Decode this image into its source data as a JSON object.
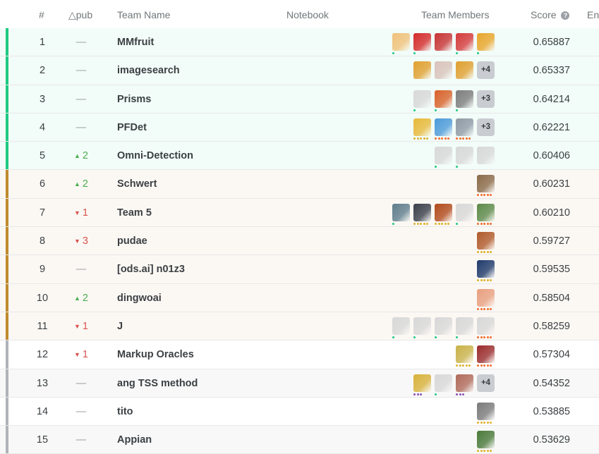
{
  "columns": {
    "rank": "#",
    "delta": "△pub",
    "team": "Team Name",
    "notebook": "Notebook",
    "members": "Team Members",
    "score": "Score",
    "entries": "En"
  },
  "colors": {
    "gold_stripe": "#20beff",
    "green_stripe": "#1ec981",
    "bronze_stripe": "#c08a2e",
    "grey_stripe": "#b0b3b8",
    "up": "#4caf50",
    "down": "#d9534f",
    "row_gold": "#f2fcf8",
    "row_bronze": "#fbf8f4",
    "row_plain": "#f8f8f8"
  },
  "rows": [
    {
      "rank": "1",
      "delta": "—",
      "dir": "none",
      "team": "MMfruit",
      "score": "0.65887",
      "tier": "green",
      "members": [
        {
          "c": "#f0c27a",
          "d": "green"
        },
        {
          "c": "#d42b2b",
          "d": "green"
        },
        {
          "c": "#c73434",
          "d": "none"
        },
        {
          "c": "#d43a3a",
          "d": "green"
        },
        {
          "c": "#e8a62c",
          "d": "green"
        }
      ],
      "more": ""
    },
    {
      "rank": "2",
      "delta": "—",
      "dir": "none",
      "team": "imagesearch",
      "score": "0.65337",
      "tier": "green",
      "members": [
        {
          "c": "#e0a030",
          "d": "none"
        },
        {
          "c": "#d9c3bb",
          "d": "none"
        },
        {
          "c": "#e0a030",
          "d": "none"
        }
      ],
      "more": "+4"
    },
    {
      "rank": "3",
      "delta": "—",
      "dir": "none",
      "team": "Prisms",
      "score": "0.64214",
      "tier": "green",
      "members": [
        {
          "c": "#d8d8d8",
          "d": "green"
        },
        {
          "c": "#d9622a",
          "d": "green"
        },
        {
          "c": "#7d7d7d",
          "d": "green"
        }
      ],
      "more": "+3"
    },
    {
      "rank": "4",
      "delta": "—",
      "dir": "none",
      "team": "PFDet",
      "score": "0.62221",
      "tier": "green",
      "members": [
        {
          "c": "#e8b93a",
          "d": "gold"
        },
        {
          "c": "#4d9ad9",
          "d": "orange"
        },
        {
          "c": "#8f9aa6",
          "d": "orange"
        }
      ],
      "more": "+3"
    },
    {
      "rank": "5",
      "delta": "2",
      "dir": "up",
      "team": "Omni-Detection",
      "score": "0.60406",
      "tier": "green",
      "members": [
        {
          "c": "#d8d8d8",
          "d": "green"
        },
        {
          "c": "#d8d8d8",
          "d": "green"
        },
        {
          "c": "#d8d8d8",
          "d": "none"
        }
      ],
      "more": ""
    },
    {
      "rank": "6",
      "delta": "2",
      "dir": "up",
      "team": "Schwert",
      "score": "0.60231",
      "tier": "bronze",
      "members": [
        {
          "c": "#8a6a4a",
          "d": "orange"
        }
      ],
      "more": ""
    },
    {
      "rank": "7",
      "delta": "1",
      "dir": "down",
      "team": "Team 5",
      "score": "0.60210",
      "tier": "bronze",
      "members": [
        {
          "c": "#5f7d8c",
          "d": "green"
        },
        {
          "c": "#3a3f4a",
          "d": "gold"
        },
        {
          "c": "#b04a1c",
          "d": "gold"
        },
        {
          "c": "#d8d8d8",
          "d": "green"
        },
        {
          "c": "#5d8a4a",
          "d": "orange"
        }
      ],
      "more": ""
    },
    {
      "rank": "8",
      "delta": "3",
      "dir": "down",
      "team": "pudae",
      "score": "0.59727",
      "tier": "bronze",
      "members": [
        {
          "c": "#b05a2a",
          "d": "gold"
        }
      ],
      "more": ""
    },
    {
      "rank": "9",
      "delta": "—",
      "dir": "none",
      "team": "[ods.ai] n01z3",
      "score": "0.59535",
      "tier": "bronze",
      "members": [
        {
          "c": "#1f3a6b",
          "d": "gold"
        }
      ],
      "more": ""
    },
    {
      "rank": "10",
      "delta": "2",
      "dir": "up",
      "team": "dingwoai",
      "score": "0.58504",
      "tier": "bronze",
      "members": [
        {
          "c": "#e8a080",
          "d": "orange"
        }
      ],
      "more": ""
    },
    {
      "rank": "11",
      "delta": "1",
      "dir": "down",
      "team": "J",
      "score": "0.58259",
      "tier": "bronze",
      "members": [
        {
          "c": "#d8d8d8",
          "d": "green"
        },
        {
          "c": "#d8d8d8",
          "d": "green"
        },
        {
          "c": "#d8d8d8",
          "d": "green"
        },
        {
          "c": "#d8d8d8",
          "d": "green"
        },
        {
          "c": "#d8d8d8",
          "d": "orange"
        }
      ],
      "more": ""
    },
    {
      "rank": "12",
      "delta": "1",
      "dir": "down",
      "team": "Markup Oracles",
      "score": "0.57304",
      "tier": "grey",
      "members": [
        {
          "c": "#c9b24a",
          "d": "gold"
        },
        {
          "c": "#9a2c2c",
          "d": "orange"
        }
      ],
      "more": ""
    },
    {
      "rank": "13",
      "delta": "—",
      "dir": "none",
      "team": "ang TSS method",
      "score": "0.54352",
      "tier": "grey",
      "members": [
        {
          "c": "#d8b23a",
          "d": "purple"
        },
        {
          "c": "#d8d8d8",
          "d": "green"
        },
        {
          "c": "#b06a5a",
          "d": "purple"
        }
      ],
      "more": "+4"
    },
    {
      "rank": "14",
      "delta": "—",
      "dir": "none",
      "team": "tito",
      "score": "0.53885",
      "tier": "grey",
      "members": [
        {
          "c": "#7a7a7a",
          "d": "gold"
        }
      ],
      "more": ""
    },
    {
      "rank": "15",
      "delta": "—",
      "dir": "none",
      "team": "Appian",
      "score": "0.53629",
      "tier": "grey",
      "members": [
        {
          "c": "#4a7a3a",
          "d": "gold"
        }
      ],
      "more": ""
    }
  ]
}
